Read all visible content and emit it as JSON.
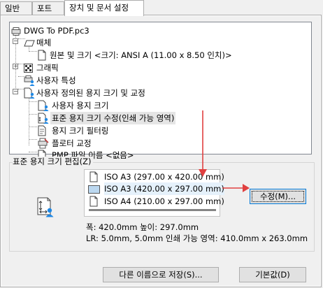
{
  "tabs": [
    {
      "label": "일반"
    },
    {
      "label": "포트"
    },
    {
      "label": "장치 및 문서 설정"
    }
  ],
  "tree": {
    "items": [
      {
        "label": "DWG To PDF.pc3",
        "icon": "plotter-icon"
      },
      {
        "label": "매체",
        "icon": "media-icon"
      },
      {
        "label": "원본 및 크기 <크기: ANSI A (11.00 x 8.50 인치)>",
        "icon": "page-icon"
      },
      {
        "label": "그래픽",
        "icon": "graphics-icon"
      },
      {
        "label": "사용자 특성",
        "icon": "user-properties-icon"
      },
      {
        "label": "사용자 정의된 용지 크기 및 교정",
        "icon": "custom-paper-icon"
      },
      {
        "label": "사용자 용지 크기",
        "icon": "user-paper-icon"
      },
      {
        "label": "표준 용지 크기 수정(인쇄 가능 영역)",
        "icon": "modify-paper-icon"
      },
      {
        "label": "용지 크기 필터링",
        "icon": "filter-paper-icon"
      },
      {
        "label": "플로터 교정",
        "icon": "plotter-calibration-icon"
      },
      {
        "label": "PMP 파일 이름 <없음>",
        "icon": "pmp-file-icon"
      }
    ]
  },
  "group": {
    "title": "표준 용지 크기 편집(Z)",
    "list_items": [
      {
        "label": "ISO A3 (297.00 x 420.00 mm)",
        "icon": "portrait-page-icon"
      },
      {
        "label": "ISO A3 (420.00 x 297.00 mm)",
        "icon": "landscape-page-icon"
      },
      {
        "label": "ISO A4 (210.00 x 297.00 mm)",
        "icon": "portrait-page-icon"
      }
    ],
    "modify_button": "수정(M)...",
    "info_line1": "폭: 420.0mm 높이: 297.0mm",
    "info_line2": "LR: 5.0mm, 5.0mm  인쇄 가능 영역: 410.0mm x 263.0mm"
  },
  "footer": {
    "save_as_button": "다른 이름으로 저장(S)...",
    "default_button": "기본값(D)"
  },
  "colors": {
    "annotation_arrow": "#e04040",
    "user_icon": "#1e88e5"
  }
}
